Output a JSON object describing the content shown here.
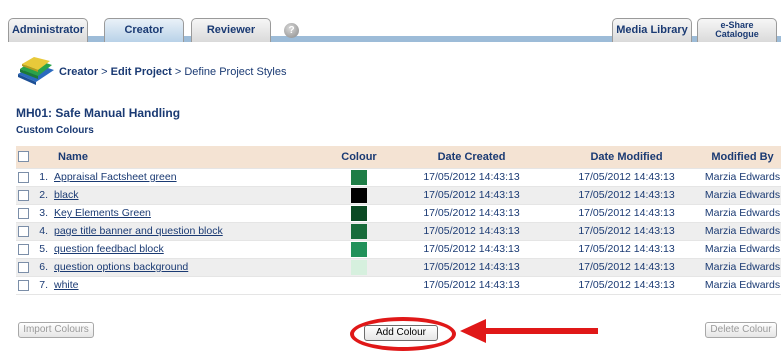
{
  "tabs": [
    {
      "label": "Administrator",
      "active": false
    },
    {
      "label": "Creator",
      "active": true
    },
    {
      "label": "Reviewer",
      "active": false
    }
  ],
  "right_tabs": [
    {
      "label": "Media Library"
    },
    {
      "label_line1": "e-Share",
      "label_line2": "Catalogue"
    }
  ],
  "breadcrumb": {
    "creator": "Creator",
    "sep1": " > ",
    "edit_project": "Edit Project",
    "sep2": " > ",
    "current": "Define Project Styles"
  },
  "project_title": "MH01: Safe Manual Handling",
  "section_title": "Custom Colours",
  "table": {
    "headers": {
      "name": "Name",
      "colour": "Colour",
      "date_created": "Date Created",
      "date_modified": "Date Modified",
      "modified_by": "Modified By"
    },
    "rows": [
      {
        "num": "1.",
        "name": "Appraisal Factsheet green",
        "colour": "#1e7d46",
        "created": "17/05/2012 14:43:13",
        "modified": "17/05/2012 14:43:13",
        "by": "Marzia Edwards"
      },
      {
        "num": "2.",
        "name": "black",
        "colour": "#000000",
        "created": "17/05/2012 14:43:13",
        "modified": "17/05/2012 14:43:13",
        "by": "Marzia Edwards"
      },
      {
        "num": "3.",
        "name": "Key Elements Green",
        "colour": "#0b4a24",
        "created": "17/05/2012 14:43:13",
        "modified": "17/05/2012 14:43:13",
        "by": "Marzia Edwards"
      },
      {
        "num": "4.",
        "name": "page title banner and question block",
        "colour": "#176b3a",
        "created": "17/05/2012 14:43:13",
        "modified": "17/05/2012 14:43:13",
        "by": "Marzia Edwards"
      },
      {
        "num": "5.",
        "name": "question feedbacl block",
        "colour": "#22915a",
        "created": "17/05/2012 14:43:13",
        "modified": "17/05/2012 14:43:13",
        "by": "Marzia Edwards"
      },
      {
        "num": "6.",
        "name": "question options background",
        "colour": "#d6f0de",
        "created": "17/05/2012 14:43:13",
        "modified": "17/05/2012 14:43:13",
        "by": "Marzia Edwards"
      },
      {
        "num": "7.",
        "name": "white",
        "colour": "#ffffff",
        "created": "17/05/2012 14:43:13",
        "modified": "17/05/2012 14:43:13",
        "by": "Marzia Edwards"
      }
    ]
  },
  "buttons": {
    "import": "Import Colours",
    "add": "Add Colour",
    "delete": "Delete Colour"
  },
  "colors": {
    "accent_blue": "#1a3a73",
    "header_bg": "#f4e3d3",
    "annotation_red": "#e01818"
  }
}
